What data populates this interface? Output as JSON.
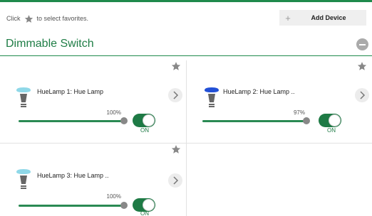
{
  "header": {
    "hint_prefix": "Click",
    "hint_suffix": "to select favorites.",
    "hint_icon": "star-icon",
    "add_device_icon": "plus-icon",
    "add_device_label": "Add Device"
  },
  "section": {
    "title": "Dimmable Switch",
    "collapse_icon": "minus-circle-icon"
  },
  "colors": {
    "accent_green": "#1f8a4c",
    "toggle_on": "#1e7a45"
  },
  "devices": [
    {
      "name": "HueLamp 1: Hue Lamp",
      "brightness_label": "100%",
      "brightness": 100,
      "state": "ON",
      "bulb_color": "#8fd8e8",
      "icon": "bulb-icon"
    },
    {
      "name": "HueLamp 2: Hue Lamp ..",
      "brightness_label": "97%",
      "brightness": 97,
      "state": "ON",
      "bulb_color": "#2250d6",
      "icon": "bulb-icon"
    },
    {
      "name": "HueLamp 3: Hue Lamp ..",
      "brightness_label": "100%",
      "brightness": 100,
      "state": "ON",
      "bulb_color": "#8fd8e8",
      "icon": "bulb-icon"
    }
  ]
}
